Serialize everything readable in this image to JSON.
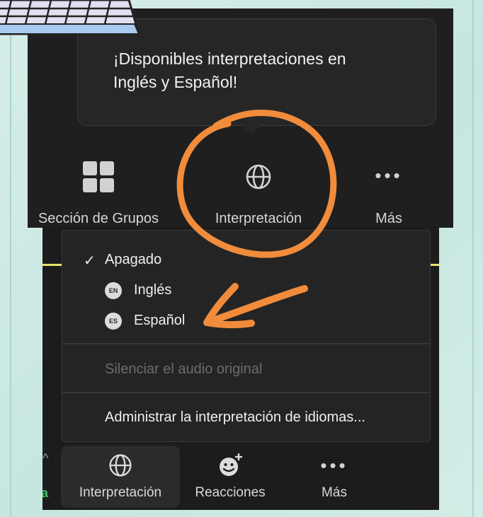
{
  "tooltip": {
    "text_line1": "¡Disponibles interpretaciones en",
    "text_line2": "Inglés y Español!"
  },
  "top_toolbar": {
    "groups_label": "Sección de Grupos",
    "interpretation_label": "Interpretación",
    "more_label": "Más"
  },
  "menu": {
    "items": [
      {
        "label": "Apagado",
        "checked": true
      },
      {
        "label": "Inglés",
        "badge": "EN"
      },
      {
        "label": "Español",
        "badge": "ES"
      }
    ],
    "mute_original_label": "Silenciar el audio original",
    "manage_label": "Administrar la interpretación de idiomas..."
  },
  "bottom_toolbar": {
    "interpretation_label": "Interpretación",
    "reactions_label": "Reacciones",
    "more_label": "Más",
    "partial_left_letter": "a"
  },
  "colors": {
    "annotation_orange": "#f08c3c",
    "accent_yellow": "#e8e36a",
    "panel_bg": "#1f1f1f"
  },
  "icons": {
    "groups": "grid-icon",
    "interpretation": "globe-icon",
    "more": "ellipsis-icon",
    "reactions": "smiley-plus-icon",
    "checked": "checkmark-icon"
  }
}
